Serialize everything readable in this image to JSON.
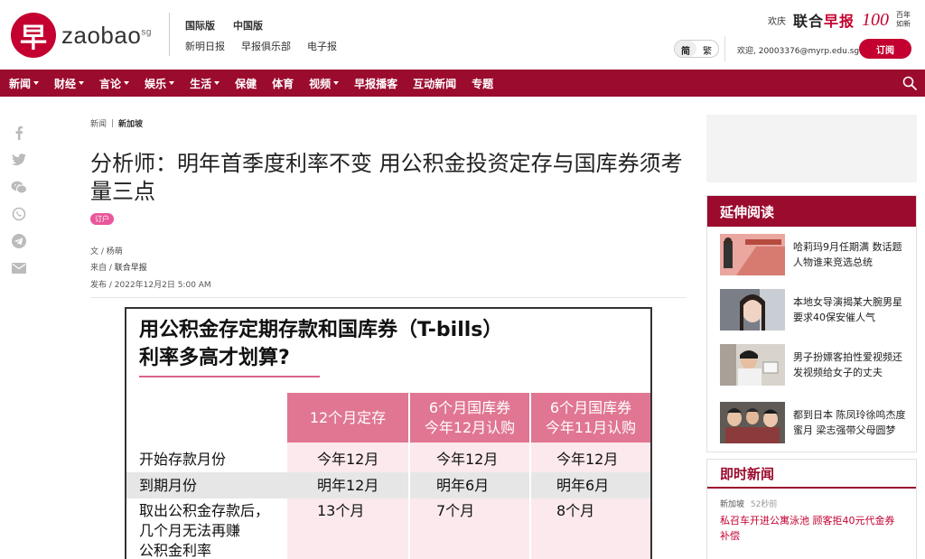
{
  "header": {
    "logo_char": "早",
    "logo_text": "zaobao",
    "logo_sg": "sg",
    "editions": [
      "国际版",
      "中国版"
    ],
    "sublinks": [
      "新明日报",
      "早报俱乐部",
      "电子报"
    ],
    "celebrate_word": "欢庆",
    "brand_left": "联合",
    "brand_right": "早报",
    "hundred": "100",
    "years_line1": "百年",
    "years_line2": "如新",
    "lang_simplified": "简",
    "lang_traditional": "繁",
    "welcome": "欢迎, 20003376@myrp.edu.sg",
    "subscribe": "订阅"
  },
  "nav": {
    "items": [
      {
        "label": "新闻",
        "dropdown": true
      },
      {
        "label": "财经",
        "dropdown": true
      },
      {
        "label": "言论",
        "dropdown": true
      },
      {
        "label": "娱乐",
        "dropdown": true
      },
      {
        "label": "生活",
        "dropdown": true
      },
      {
        "label": "保健",
        "dropdown": false
      },
      {
        "label": "体育",
        "dropdown": false
      },
      {
        "label": "视频",
        "dropdown": true
      },
      {
        "label": "早报播客",
        "dropdown": false
      },
      {
        "label": "互动新闻",
        "dropdown": false
      },
      {
        "label": "专题",
        "dropdown": false
      }
    ]
  },
  "article": {
    "breadcrumb": [
      "新闻",
      "新加坡"
    ],
    "title": "分析师：明年首季度利率不变 用公积金投资定存与国库券须考量三点",
    "tag": "订户",
    "author_label": "文 / ",
    "author": "杨萌",
    "source_label": "来自 / ",
    "source": "联合早报",
    "published_label": "发布 / ",
    "published": "2022年12月2日 5:00 AM"
  },
  "infographic": {
    "title_line1": "用公积金存定期存款和国库券（T-bills）",
    "title_line2": "利率多高才划算?",
    "columns": [
      {
        "line1": "12个月定存",
        "line2": ""
      },
      {
        "line1": "6个月国库券",
        "line2": "今年12月认购"
      },
      {
        "line1": "6个月国库券",
        "line2": "今年11月认购"
      }
    ],
    "rows": [
      {
        "label": "开始存款月份",
        "cells": [
          "今年12月",
          "今年12月",
          "今年12月"
        ]
      },
      {
        "label": "到期月份",
        "cells": [
          "明年12月",
          "明年6月",
          "明年6月"
        ]
      },
      {
        "label_lines": [
          "取出公积金存款后，",
          "几个月无法再赚",
          "公积金利率"
        ],
        "cells": [
          "13个月",
          "7个月",
          "8个月"
        ]
      }
    ]
  },
  "sidebar": {
    "extended_title": "延伸阅读",
    "extended": [
      {
        "title": "哈莉玛9月任期满 数话题人物谁来竞选总统"
      },
      {
        "title": "本地女导演揭某大腕男星要求40保安催人气"
      },
      {
        "title": "男子扮嫖客拍性爱视频还发视频给女子的丈夫"
      },
      {
        "title": "都到日本 陈凤玲徐鸣杰度蜜月 梁志强带父母圆梦"
      }
    ],
    "breaking_title": "即时新闻",
    "breaking": [
      {
        "category": "新加坡",
        "time": "52秒前",
        "title": "私召车开进公寓泳池 顾客拒40元代金券补偿"
      }
    ]
  },
  "colors": {
    "brand_red": "#c3002f",
    "nav_red": "#9b0b2e",
    "infographic_pink": "#e07692"
  }
}
